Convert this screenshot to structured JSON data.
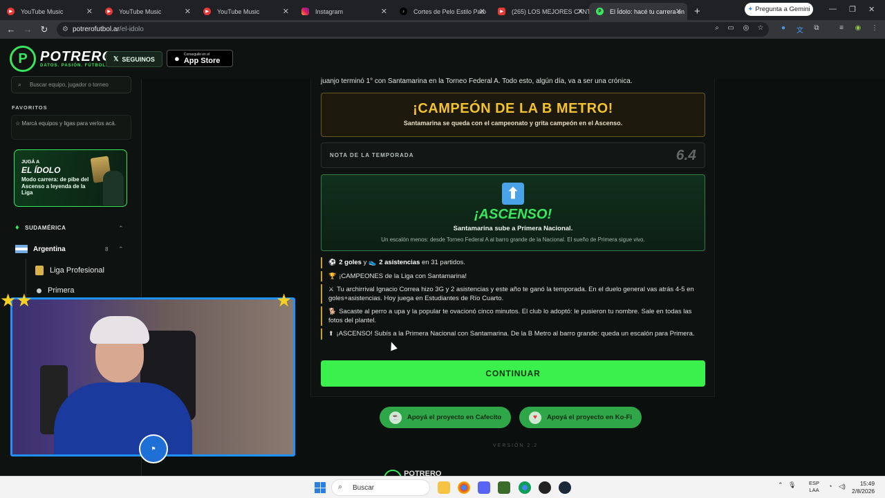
{
  "browser": {
    "tabs": [
      {
        "title": "YouTube Music",
        "favicon": "youtube-music-icon"
      },
      {
        "title": "YouTube Music",
        "favicon": "youtube-music-icon"
      },
      {
        "title": "YouTube Music",
        "favicon": "youtube-music-icon"
      },
      {
        "title": "Instagram",
        "favicon": "instagram-icon"
      },
      {
        "title": "Cortes de Pelo Estilo Pato",
        "favicon": "tiktok-icon"
      },
      {
        "title": "(265) LOS MEJORES CANT",
        "favicon": "youtube-icon"
      },
      {
        "title": "El Ídolo: hacé tu carrera en",
        "favicon": "potrero-icon",
        "active": true
      }
    ],
    "new_tab": "+",
    "gemini_button": "Pregunta a Gemini",
    "url_host": "potrerofutbol.ar",
    "url_path": "/el-idolo"
  },
  "site": {
    "brand": "POTRERO",
    "tagline": "DATOS. PASIÓN. FÚTBOL.",
    "follow_label": "SEGUINOS",
    "appstore_small": "Conseguilo en el",
    "appstore_big": "App Store"
  },
  "sidebar": {
    "search_placeholder": "Buscar equipo, jugador o torneo",
    "favorites_title": "FAVORITOS",
    "favorites_hint": "Marcá equipos y ligas para verlos acá.",
    "promo": {
      "kicker": "JUGÁ A",
      "title": "EL ÍDOLO",
      "desc": "Modo carrera: de pibe del Ascenso a leyenda de la Liga"
    },
    "region": "SUDAMÉRICA",
    "country": "Argentina",
    "country_count": "8",
    "leagues": [
      "Liga Profesional",
      "Primera"
    ]
  },
  "main": {
    "intro": "juanjo terminó 1° con Santamarina en la Torneo Federal A. Todo esto, algún día, va a ser una crónica.",
    "champion_title": "¡CAMPEÓN DE LA B METRO!",
    "champion_sub": "Santamarina se queda con el campeonato y grita campeón en el Ascenso.",
    "rating_label": "NOTA DE LA TEMPORADA",
    "rating_value": "6.4",
    "promotion_title": "¡ASCENSO!",
    "promotion_sub": "Santamarina sube a Primera Nacional.",
    "promotion_desc": "Un escalón menos: desde Torneo Federal A al barro grande de la Nacional. El sueño de Primera sigue vivo.",
    "events": [
      {
        "icon": "⚽",
        "bold1": "2 goles",
        "mid": " y ",
        "icon2": "👟",
        "bold2": "2 asistencias",
        "text": " en 31 partidos."
      },
      {
        "icon": "🏆",
        "text": "¡CAMPEONES de la Liga con Santamarina!"
      },
      {
        "icon": "⚔",
        "text": "Tu archirrival Ignacio Correa hizo 3G y 2 asistencias y este año te ganó la temporada. En el duelo general vas atrás 4-5 en goles+asistencias. Hoy juega en Estudiantes de Río Cuarto."
      },
      {
        "icon": "🐕",
        "text": "Sacaste al perro a upa y la popular te ovacionó cinco minutos. El club lo adoptó: le pusieron tu nombre. Sale en todas las fotos del plantel."
      },
      {
        "icon": "⬆",
        "text": "¡ASCENSO! Subís a la Primera Nacional con Santamarina. De la B Metro al barro grande: queda un escalón para Primera."
      }
    ],
    "continue_label": "CONTINUAR",
    "support_cafecito": "Apoyá el proyecto en Cafecito",
    "support_kofi": "Apoyá el proyecto en Ko-Fi",
    "version": "VERSIÓN 2.2",
    "footer_brand": "POTRERO"
  },
  "taskbar": {
    "search_placeholder": "Buscar",
    "lang_top": "ESP",
    "lang_bottom": "LAA",
    "time": "15:49",
    "date": "2/8/2026"
  },
  "colors": {
    "accent_green": "#3bf04d",
    "champion_gold": "#f2c230",
    "highlight_border": "#c9a227",
    "webcam_border": "#1e90ff"
  }
}
